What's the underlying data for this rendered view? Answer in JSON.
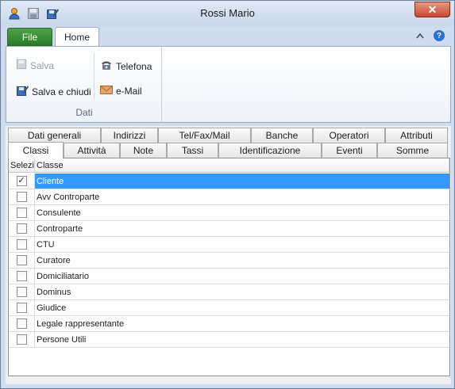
{
  "window": {
    "title": "Rossi Mario",
    "close_label": "✕"
  },
  "ribbon": {
    "tabs": {
      "file": "File",
      "home": "Home"
    },
    "group_dati": {
      "label": "Dati",
      "salva": "Salva",
      "salva_chiudi": "Salva e chiudi",
      "telefona": "Telefona",
      "email": "e-Mail"
    }
  },
  "tabs_row1": [
    "Dati generali",
    "Indirizzi",
    "Tel/Fax/Mail",
    "Banche",
    "Operatori",
    "Attributi"
  ],
  "tabs_row2": [
    "Classi",
    "Attività",
    "Note",
    "Tassi",
    "Identificazione",
    "Eventi",
    "Somme"
  ],
  "active_tab": "Classi",
  "grid": {
    "columns": [
      "Selezi",
      "Classe"
    ],
    "rows": [
      {
        "checked": true,
        "label": "Cliente"
      },
      {
        "checked": false,
        "label": "Avv Controparte"
      },
      {
        "checked": false,
        "label": "Consulente"
      },
      {
        "checked": false,
        "label": "Controparte"
      },
      {
        "checked": false,
        "label": "CTU"
      },
      {
        "checked": false,
        "label": "Curatore"
      },
      {
        "checked": false,
        "label": "Domiciliatario"
      },
      {
        "checked": false,
        "label": "Dominus"
      },
      {
        "checked": false,
        "label": "Giudice"
      },
      {
        "checked": false,
        "label": "Legale rappresentante"
      },
      {
        "checked": false,
        "label": "Persone Utili"
      }
    ]
  },
  "colors": {
    "selection": "#3399ff",
    "file_tab": "#2b7a27",
    "close": "#c9462c"
  }
}
